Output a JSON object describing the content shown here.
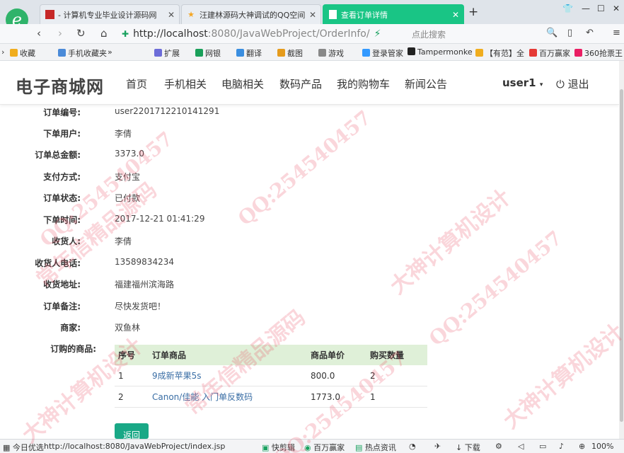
{
  "browser": {
    "tabs": [
      {
        "label": "- 计算机专业毕业设计源码网",
        "active": false
      },
      {
        "label": "汪建林源码大神调试的QQ空间",
        "active": false
      },
      {
        "label": "查看订单详情",
        "active": true
      }
    ],
    "close_glyph": "✕",
    "new_tab_glyph": "+",
    "address": {
      "host": "http://localhost",
      "rest": ":8080/JavaWebProject/OrderInfo/"
    },
    "search_placeholder": "点此搜索",
    "bookmarks": [
      {
        "label": "收藏",
        "color": "#f0ad1e"
      },
      {
        "label": "手机收藏夹",
        "color": "#4a8ad8"
      },
      {
        "label": "扩展",
        "color": "#6c6cd8"
      },
      {
        "label": "网银",
        "color": "#1aa05a"
      },
      {
        "label": "翻译",
        "color": "#3a8ee0"
      },
      {
        "label": "截图",
        "color": "#e59b1c"
      },
      {
        "label": "游戏",
        "color": "#888888"
      },
      {
        "label": "登录管家",
        "color": "#3399ff"
      },
      {
        "label": "Tampermonke",
        "color": "#222222"
      },
      {
        "label": "【有范】全",
        "color": "#f0ad1e"
      },
      {
        "label": "百万赢家",
        "color": "#e53935"
      },
      {
        "label": "360抢票王",
        "color": "#e91e63"
      }
    ]
  },
  "header": {
    "brand": "电子商城网",
    "menu": [
      "首页",
      "手机相关",
      "电脑相关",
      "数码产品",
      "我的购物车",
      "新闻公告"
    ],
    "user": "user1",
    "logout": "退出"
  },
  "order": {
    "fields": [
      {
        "label": "订单编号:",
        "value": "user2201712210141291"
      },
      {
        "label": "下单用户:",
        "value": "李倩"
      },
      {
        "label": "订单总金额:",
        "value": "3373.0"
      },
      {
        "label": "支付方式:",
        "value": "支付宝"
      },
      {
        "label": "订单状态:",
        "value": "已付款"
      },
      {
        "label": "下单时间:",
        "value": "2017-12-21 01:41:29"
      },
      {
        "label": "收货人:",
        "value": "李倩"
      },
      {
        "label": "收货人电话:",
        "value": "13589834234"
      },
      {
        "label": "收货地址:",
        "value": "福建福州滨海路"
      },
      {
        "label": "订单备注:",
        "value": "尽快发货吧！"
      },
      {
        "label": "商家:",
        "value": "双鱼林"
      }
    ],
    "goods_label": "订购的商品:",
    "goods_headers": [
      "序号",
      "订单商品",
      "商品单价",
      "购买数量"
    ],
    "goods": [
      {
        "no": "1",
        "name": "9成新苹果5s",
        "price": "800.0",
        "qty": "2"
      },
      {
        "no": "2",
        "name": "Canon/佳能 入门单反数码",
        "price": "1773.0",
        "qty": "1"
      }
    ],
    "back_button": "返回"
  },
  "statusbar": {
    "left": "今日优选",
    "url": "http://localhost:8080/JavaWebProject/index.jsp",
    "items": [
      "快剪辑",
      "百万赢家",
      "热点资讯",
      "下载"
    ],
    "zoom": "100%"
  },
  "watermark": [
    "QQ:254540457",
    "大神计算机设计",
    "常年信精品源码"
  ],
  "colors": {
    "accent": "#19c585",
    "button": "#19a886",
    "table_header": "#dff0d8",
    "link": "#3a6ea5"
  }
}
